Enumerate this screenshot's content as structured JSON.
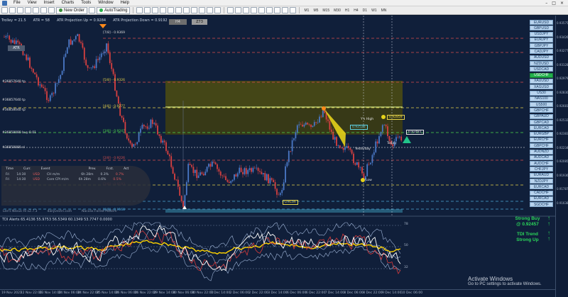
{
  "menu": {
    "items": [
      "File",
      "View",
      "Insert",
      "Charts",
      "Tools",
      "Window",
      "Help"
    ]
  },
  "toolbar": {
    "new_order": "New Order",
    "autotrading": "AutoTrading",
    "timeframes": [
      "M1",
      "M5",
      "M15",
      "M30",
      "H1",
      "H4",
      "D1",
      "W1",
      "MN"
    ]
  },
  "chart": {
    "info": [
      "Trolley = 21.5",
      "ATR = 58",
      "ATR Projection Up = 0.9284",
      "ATR Projection Down = 0.9192"
    ],
    "atr_box": "ATR",
    "tf_buttons": [
      "H4",
      "Z73"
    ],
    "levels": [
      {
        "label": "[7/8] - 0.9369",
        "color": "#d8d8d8"
      },
      {
        "label": "[5/8] - 0.9326",
        "color": "#e6d24a"
      },
      {
        "label": "[4/8] - 0.9277",
        "color": "#e6d24a"
      },
      {
        "label": "[3/8] - 0.9247",
        "color": "#4ed84e"
      },
      {
        "label": "[2/8] - 0.9226",
        "color": "#d84e4e"
      },
      {
        "label": "[1/8] - 0.9193",
        "color": "#d84e4e"
      },
      {
        "label": "[0/8] - 0.9168",
        "color": "#4ea6d8"
      }
    ],
    "left_tags": [
      "#36857640 tp",
      "#36857640 tp",
      "#36858040 tp",
      "#36858080 buy 0.01",
      "#36858080 sl"
    ],
    "annotations": {
      "ys_high": "Y's High",
      "yesterday": "Yesterday",
      "low": "Low",
      "today": "Today",
      "p1": "0.92526",
      "p2": "0.92859",
      "p3": "0.92481",
      "p4": "0.9159"
    },
    "footer": [
      "Lee's Nexus Hi v2.7.3",
      "dailyvectri.com",
      "Nacolix Forest Pattern"
    ],
    "event_table": {
      "headers": [
        "Time",
        "Curr.",
        "Event",
        "",
        "Act",
        "Prev.",
        "Fcst.",
        "Act"
      ],
      "rows": [
        {
          "time": "Fri",
          "time2": "14:30",
          "curr": "USD",
          "event": "CH m/m",
          "a": "6h 28m",
          "b": "0.3%",
          "c": "0.7%"
        },
        {
          "time": "Fri",
          "time2": "14:30",
          "curr": "USD",
          "event": "Core CPI m/m",
          "a": "6h 28m",
          "b": "0.6%",
          "c": "0.5%"
        }
      ]
    }
  },
  "price_axis": [
    "0.93575",
    "0.93426",
    "0.93277",
    "0.93128",
    "0.92979",
    "0.92830",
    "0.92681",
    "0.92532",
    "0.92383",
    "0.92234",
    "0.92085",
    "0.91936",
    "0.91787",
    "0.91638"
  ],
  "currency_panel": {
    "items": [
      "EURUSD",
      "GBPUSD",
      "USDJPY",
      "EURJPY",
      "GBPJPY",
      "CADJPY",
      "AUDUSD",
      "NZDUSD",
      "USDCAD",
      "USDCHF",
      "XAUUSD",
      "XAGUSD",
      "US30",
      "NAS100",
      "US500",
      "GBPCHF",
      "GBPAUD",
      "GBPCAD",
      "EURCAD",
      "EURGBP",
      "EURCHF",
      "GBPCHF",
      "AUDNZD",
      "AUDCAD",
      "AUDCHF",
      "CHFJPY",
      "EURAUD",
      "NZDJPY",
      "EURCAD",
      "CADCHF",
      "EURCAD",
      "SGDCHF"
    ],
    "active": "USDCHF"
  },
  "tdi": {
    "title": "TDI Alerts 65.4136 55.9753 56.5349 60.1349 53.7747 0.0000",
    "signal_label": "Strong Buy",
    "signal_price": "@ 0.92457",
    "trend_label": "TDI Trend",
    "trend_value": "Strong Up",
    "levels": [
      "78",
      "50",
      "32"
    ]
  },
  "time_axis": [
    "19 Nov 2021",
    "22 Nov 22:00",
    "23 Nov 14:00",
    "24 Nov 06:00",
    "24 Nov 22:00",
    "25 Nov 14:00",
    "26 Nov 06:00",
    "26 Nov 22:00",
    "29 Nov 14:00",
    "30 Nov 06:00",
    "30 Nov 22:00",
    "1 Dec 14:00",
    "2 Dec 06:00",
    "2 Dec 22:00",
    "3 Dec 14:00",
    "6 Dec 06:00",
    "6 Dec 22:00",
    "7 Dec 14:00",
    "8 Dec 06:00",
    "8 Dec 22:00",
    "9 Dec 14:00",
    "10 Dec 06:00"
  ],
  "watermark": {
    "line1": "Activate Windows",
    "line2": "Go to PC settings to activate Windows."
  },
  "colors": {
    "background": "#101f3a",
    "bull": "#4a78c6",
    "bear": "#d84040",
    "zone": "#5a5a14",
    "tdi_price": "#ffffff",
    "tdi_signal": "#ffd400",
    "tdi_band": "#9fb5d8"
  }
}
